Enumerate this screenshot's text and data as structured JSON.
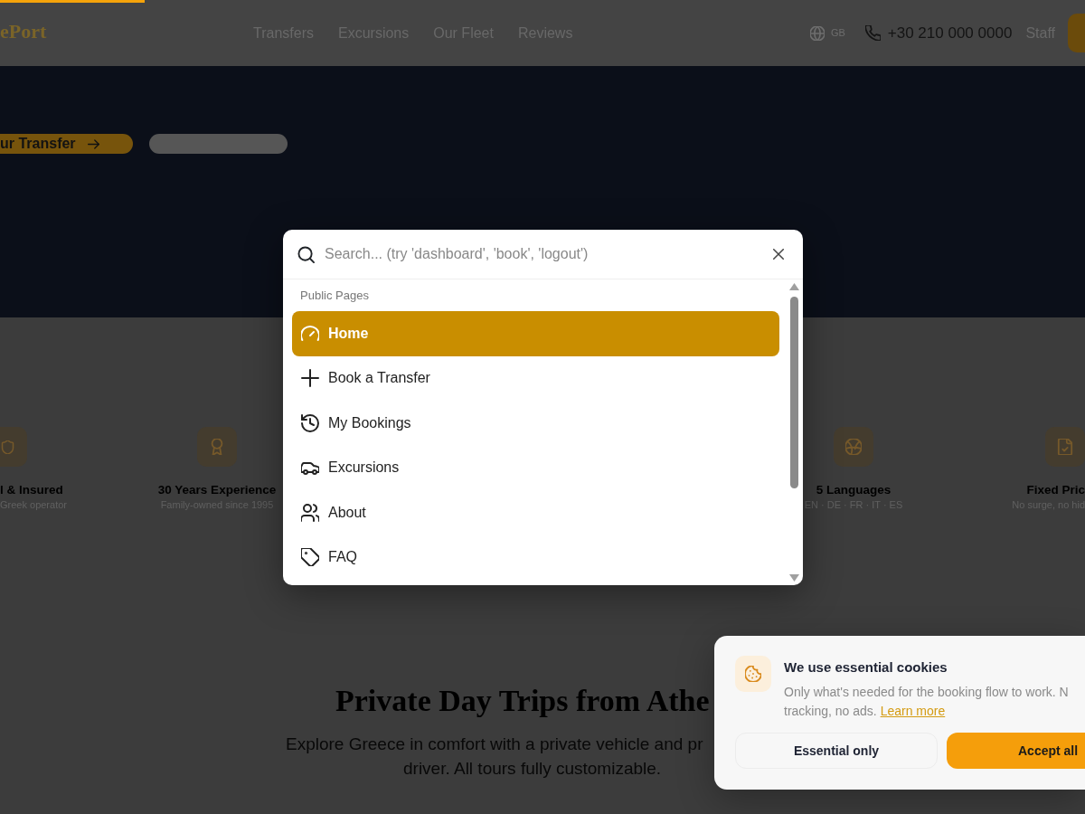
{
  "page_progress": {
    "level": 0.133
  },
  "header": {
    "logo": "ePort",
    "nav_links": [
      "Transfers",
      "Excursions",
      "Our Fleet",
      "Reviews"
    ],
    "language": "GB",
    "phone": "+30 210 000 0000",
    "staff_link": "Staff"
  },
  "hero": {
    "primary_button": "ur Transfer"
  },
  "features": [
    {
      "title": "l & Insured",
      "subtitle": "Greek operator"
    },
    {
      "title": "30 Years Experience",
      "subtitle": "Family-owned since 1995"
    },
    {
      "title": "5 Languages",
      "subtitle": "EN · DE · FR · IT · ES"
    },
    {
      "title": "Fixed Pric",
      "subtitle": "No surge, no hid"
    }
  ],
  "day_trips": {
    "title": "Private Day Trips from Athe",
    "subtitle_lines": [
      "Explore Greece in comfort with a private vehicle and pr",
      "driver. All tours fully customizable."
    ]
  },
  "command_palette": {
    "placeholder": "Search... (try 'dashboard', 'book', 'logout')",
    "groups": [
      {
        "label": "Public Pages",
        "items": [
          {
            "label": "Home",
            "selected": true
          },
          {
            "label": "Book a Transfer",
            "selected": false
          },
          {
            "label": "My Bookings",
            "selected": false
          },
          {
            "label": "Excursions",
            "selected": false
          },
          {
            "label": "About",
            "selected": false
          },
          {
            "label": "FAQ",
            "selected": false
          }
        ]
      }
    ]
  },
  "cookie_banner": {
    "title": "We use essential cookies",
    "text_lines": [
      "Only what's needed for the booking flow to work. N",
      "tracking, no ads."
    ],
    "link": "Learn more",
    "buttons": [
      {
        "label": "Essential only",
        "kind": "secondary"
      },
      {
        "label": "Accept all",
        "kind": "primary"
      }
    ]
  }
}
